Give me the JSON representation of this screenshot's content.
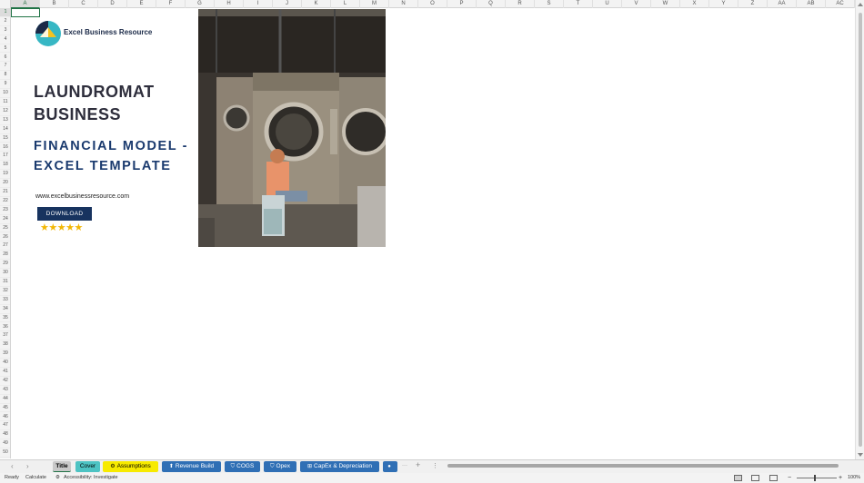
{
  "columns": [
    "A",
    "B",
    "C",
    "D",
    "E",
    "F",
    "G",
    "H",
    "I",
    "J",
    "K",
    "L",
    "M",
    "N",
    "O",
    "P",
    "Q",
    "R",
    "S",
    "T",
    "U",
    "V",
    "W",
    "X",
    "Y",
    "Z",
    "AA",
    "AB",
    "AC"
  ],
  "rows": [
    "1",
    "2",
    "3",
    "4",
    "5",
    "6",
    "7",
    "8",
    "9",
    "10",
    "11",
    "12",
    "13",
    "14",
    "15",
    "16",
    "17",
    "18",
    "19",
    "20",
    "21",
    "22",
    "23",
    "24",
    "25",
    "26",
    "27",
    "28",
    "29",
    "30",
    "31",
    "32",
    "33",
    "34",
    "35",
    "36",
    "37",
    "38",
    "39",
    "40",
    "41",
    "42",
    "43",
    "44",
    "45",
    "46",
    "47",
    "48",
    "49",
    "50"
  ],
  "cover": {
    "brand": "Excel Business Resource",
    "title_line1": "LAUNDROMAT",
    "title_line2": "BUSINESS",
    "subtitle_line1": "FINANCIAL MODEL -",
    "subtitle_line2": "EXCEL TEMPLATE",
    "website": "www.excelbusinessresource.com",
    "download_label": "DOWNLOAD",
    "stars": "★★★★★",
    "rating": 5
  },
  "tabs": [
    {
      "label": "Title",
      "icon": "",
      "bg": "#c8c8c8",
      "fg": "#000000",
      "active": true
    },
    {
      "label": "Cover",
      "icon": "",
      "bg": "#4dc3c3",
      "fg": "#000000"
    },
    {
      "label": "Assumptions",
      "icon": "⚙",
      "bg": "#f7ea00",
      "fg": "#000000"
    },
    {
      "label": "Revenue Build",
      "icon": "⬆",
      "bg": "#2f6fb5",
      "fg": "#ffffff"
    },
    {
      "label": "COGS",
      "icon": "⛉",
      "bg": "#2f6fb5",
      "fg": "#ffffff"
    },
    {
      "label": "Opex",
      "icon": "⛉",
      "bg": "#2f6fb5",
      "fg": "#ffffff"
    },
    {
      "label": "CapEx & Depreciation",
      "icon": "⊞",
      "bg": "#2f6fb5",
      "fg": "#ffffff"
    },
    {
      "label": "",
      "icon": "●",
      "bg": "#2f6fb5",
      "fg": "#ffffff"
    }
  ],
  "tabbar": {
    "prev": "‹",
    "next": "›",
    "more": "···",
    "add": "+",
    "options": "⋮"
  },
  "status": {
    "ready": "Ready",
    "calculate": "Calculate",
    "accessibility": "Accessibility: Investigate",
    "zoom": "100%"
  },
  "colors": {
    "excel_green": "#217346",
    "title_dark": "#2e2e3c",
    "navy": "#1a3a6e",
    "star": "#f2b705"
  }
}
